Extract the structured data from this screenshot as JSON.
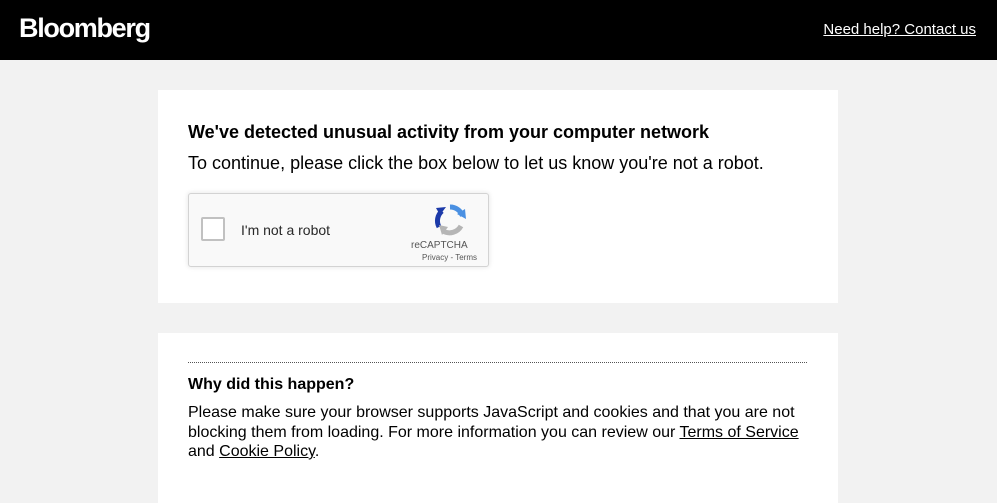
{
  "header": {
    "logo_text": "Bloomberg",
    "help_link": "Need help? Contact us"
  },
  "challenge": {
    "heading": "We've detected unusual activity from your computer network",
    "subheading": "To continue, please click the box below to let us know you're not a robot."
  },
  "recaptcha": {
    "checkbox_label": "I'm not a robot",
    "brand": "reCAPTCHA",
    "privacy_link": "Privacy",
    "separator": " - ",
    "terms_link": "Terms",
    "icon": "recaptcha-logo-icon"
  },
  "why": {
    "heading": "Why did this happen?",
    "body_before": "Please make sure your browser supports JavaScript and cookies and that you are not blocking them from loading. For more information you can review our ",
    "terms_link": "Terms of Service",
    "middle": " and ",
    "cookie_link": "Cookie Policy",
    "end": "."
  },
  "colors": {
    "topbar": "#000000",
    "page_background": "#f2f2f2",
    "card_background": "#ffffff",
    "recaptcha_blue": "#4a90e2",
    "recaptcha_dark_blue": "#1c3aa9",
    "recaptcha_gray": "#c1c1c1"
  }
}
